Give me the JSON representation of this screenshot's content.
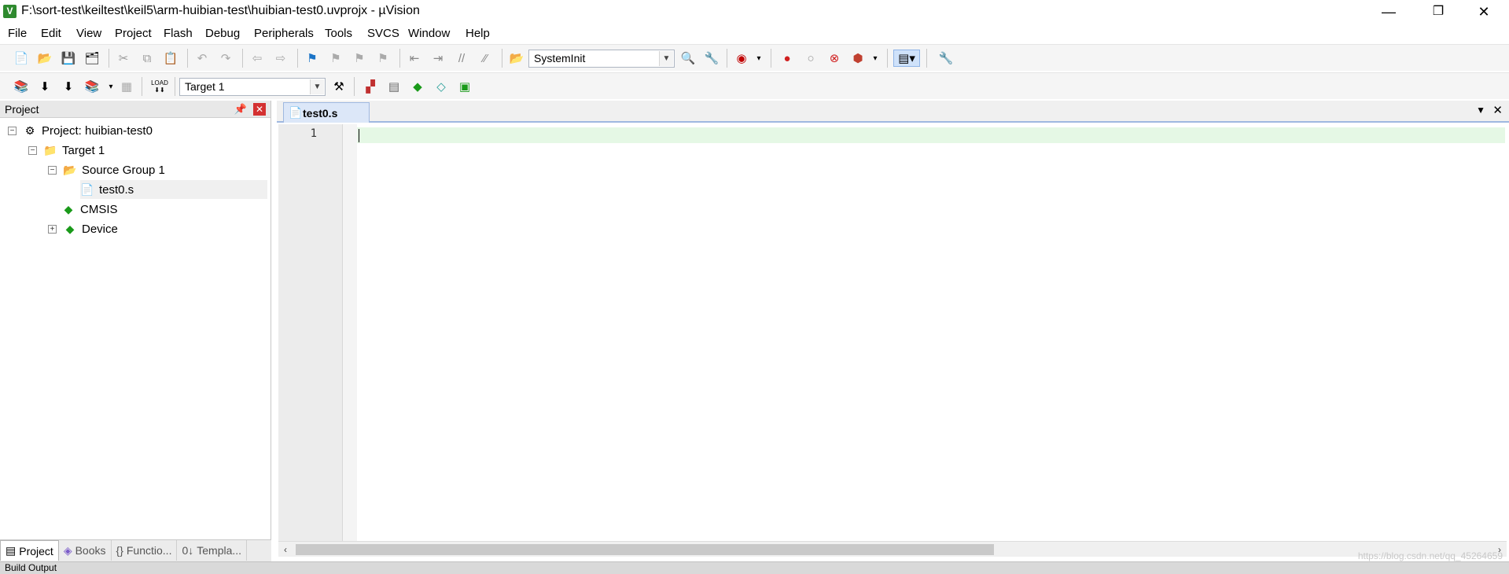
{
  "window": {
    "title": "F:\\sort-test\\keiltest\\keil5\\arm-huibian-test\\huibian-test0.uvprojx - µVision",
    "app_icon": "V",
    "minimize": "—",
    "maximize": "❐",
    "close": "✕"
  },
  "menu": [
    "File",
    "Edit",
    "View",
    "Project",
    "Flash",
    "Debug",
    "Peripherals",
    "Tools",
    "SVCS",
    "Window",
    "Help"
  ],
  "toolbar": {
    "function_combo": "SystemInit",
    "target_combo": "Target 1",
    "load_label": "LOAD"
  },
  "project_panel": {
    "title": "Project",
    "pin": "📌",
    "close": "✕",
    "tree": {
      "project": "Project: huibian-test0",
      "target": "Target 1",
      "group": "Source Group 1",
      "file": "test0.s",
      "cmsis": "CMSIS",
      "device": "Device"
    },
    "tabs": [
      "Project",
      "Books",
      "Functio...",
      "Templa..."
    ]
  },
  "editor": {
    "tab": "test0.s",
    "line_numbers": [
      "1"
    ]
  },
  "status": {
    "build_output": "Build Output"
  },
  "watermark": "https://blog.csdn.net/qq_45264659",
  "colors": {
    "current_line": "#e5f8e5",
    "tab_active": "#dce7f8",
    "panel_header": "#e8e8e8"
  }
}
